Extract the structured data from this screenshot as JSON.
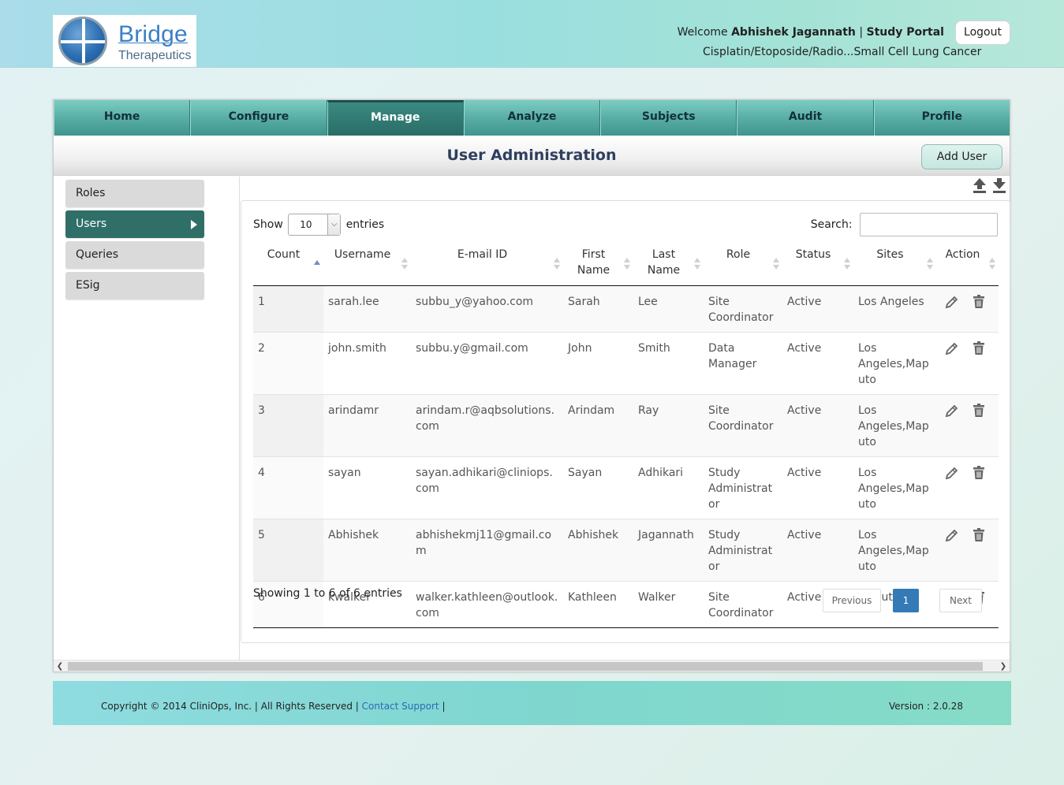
{
  "header": {
    "logo": {
      "name": "Bridge",
      "subtitle": "Therapeutics"
    },
    "welcome_prefix": "Welcome",
    "user_name": "Abhishek Jagannath",
    "separator": "|",
    "portal": "Study Portal",
    "study": "Cisplatin/Etoposide/Radio...Small Cell Lung Cancer",
    "logout_label": "Logout"
  },
  "nav": {
    "items": [
      {
        "label": "Home"
      },
      {
        "label": "Configure"
      },
      {
        "label": "Manage",
        "active": true
      },
      {
        "label": "Analyze"
      },
      {
        "label": "Subjects"
      },
      {
        "label": "Audit"
      },
      {
        "label": "Profile"
      }
    ]
  },
  "page": {
    "title": "User Administration",
    "add_user_label": "Add User"
  },
  "sidebar": {
    "items": [
      {
        "label": "Roles"
      },
      {
        "label": "Users",
        "active": true
      },
      {
        "label": "Queries"
      },
      {
        "label": "ESig"
      }
    ]
  },
  "toolbar": {
    "icons": [
      "upload-icon",
      "download-icon"
    ]
  },
  "table": {
    "show_label": "Show",
    "page_size": "10",
    "entries_label": "entries",
    "search_label": "Search:",
    "search_value": "",
    "columns": [
      "Count",
      "Username",
      "E-mail ID",
      "First Name",
      "Last Name",
      "Role",
      "Status",
      "Sites",
      "Action"
    ],
    "rows": [
      {
        "count": "1",
        "username": "sarah.lee",
        "email": "subbu_y@yahoo.com",
        "first": "Sarah",
        "last": "Lee",
        "role": "Site Coordinator",
        "status": "Active",
        "sites": "Los Angeles"
      },
      {
        "count": "2",
        "username": "john.smith",
        "email": "subbu.y@gmail.com",
        "first": "John",
        "last": "Smith",
        "role": "Data Manager",
        "status": "Active",
        "sites": "Los Angeles,Maputo"
      },
      {
        "count": "3",
        "username": "arindamr",
        "email": "arindam.r@aqbsolutions.com",
        "first": "Arindam",
        "last": "Ray",
        "role": "Site Coordinator",
        "status": "Active",
        "sites": "Los Angeles,Maputo"
      },
      {
        "count": "4",
        "username": "sayan",
        "email": "sayan.adhikari@cliniops.com",
        "first": "Sayan",
        "last": "Adhikari",
        "role": "Study Administrator",
        "status": "Active",
        "sites": "Los Angeles,Maputo"
      },
      {
        "count": "5",
        "username": "Abhishek",
        "email": "abhishekmj11@gmail.com",
        "first": "Abhishek",
        "last": "Jagannath",
        "role": "Study Administrator",
        "status": "Active",
        "sites": "Los Angeles,Maputo"
      },
      {
        "count": "6",
        "username": "kwalker",
        "email": "walker.kathleen@outlook.com",
        "first": "Kathleen",
        "last": "Walker",
        "role": "Site Coordinator",
        "status": "Active",
        "sites": "Maputo"
      }
    ],
    "info": "Showing 1 to 6 of 6 entries",
    "pagination": {
      "previous": "Previous",
      "current": "1",
      "next": "Next"
    }
  },
  "footer": {
    "copyright": "Copyright © 2014 CliniOps, Inc. | All Rights Reserved |",
    "support_link": "Contact Support",
    "trailing": "|",
    "version": "Version : 2.0.28"
  },
  "colors": {
    "nav_active": "#2a6c66",
    "sidebar_active": "#2f6f68",
    "page_title": "#2e3f5e",
    "link": "#2a6ab5",
    "pager_current": "#337ab7"
  }
}
